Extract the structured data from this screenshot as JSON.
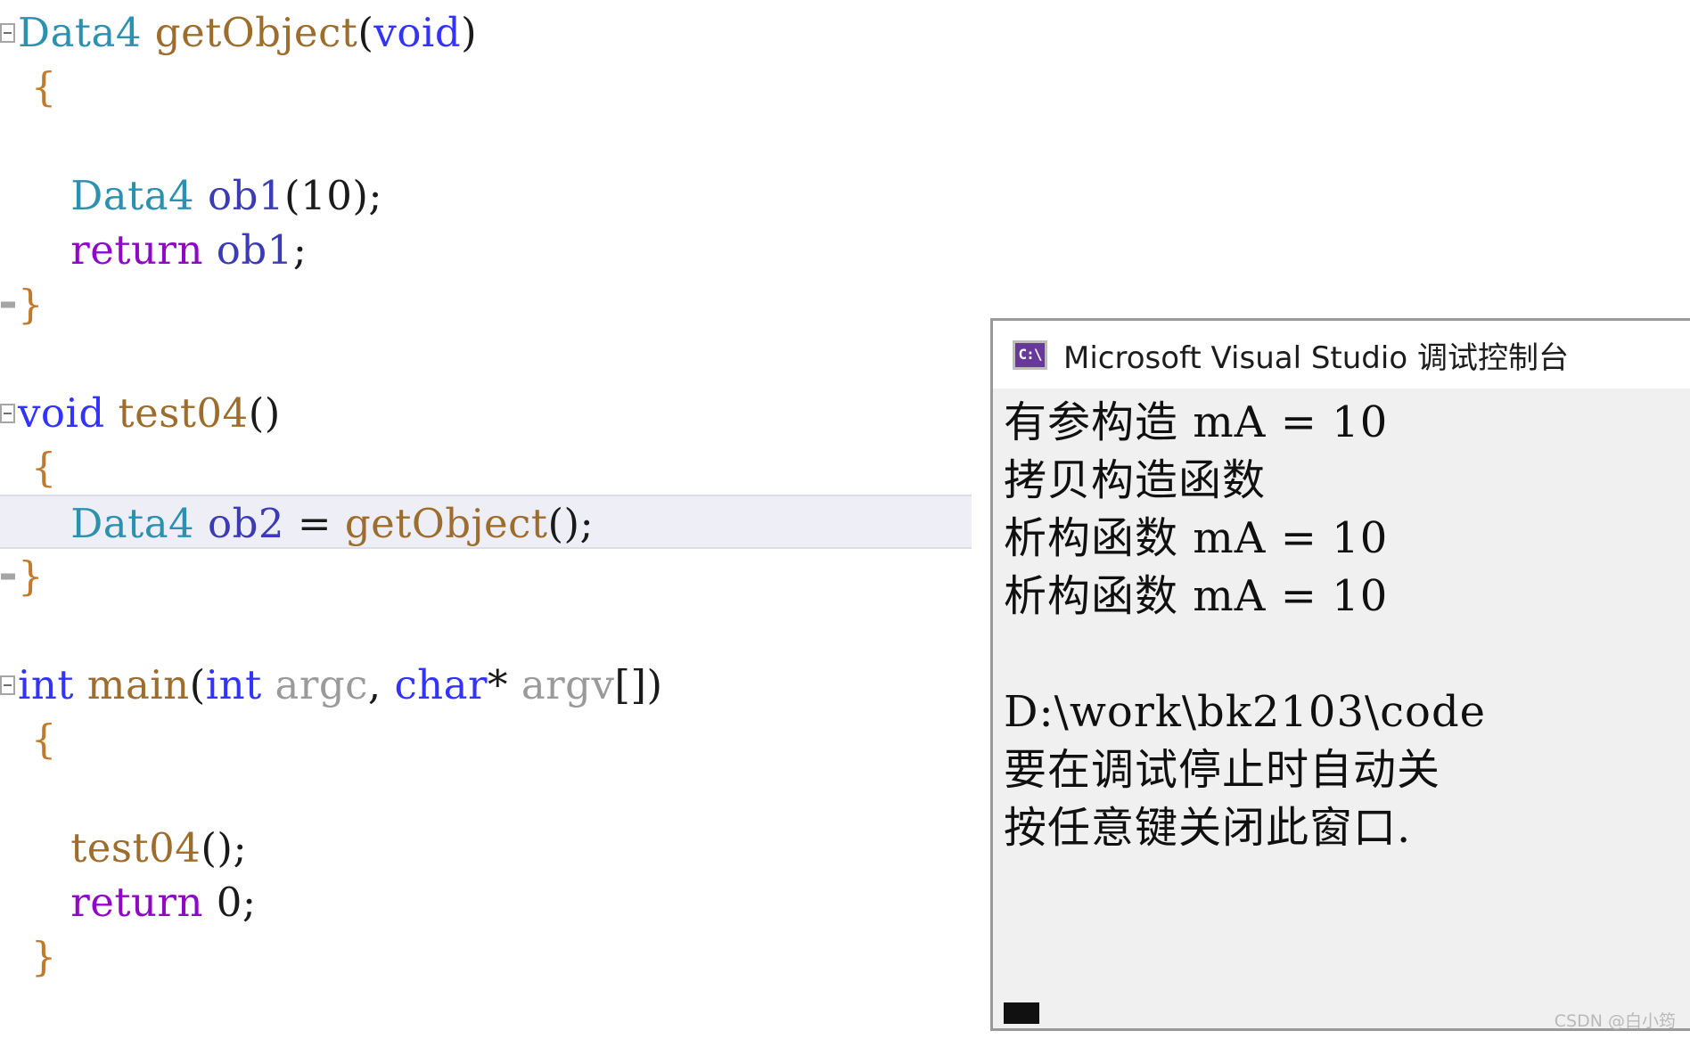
{
  "editor": {
    "name": "visual-studio-code-editor",
    "background": "#ffffff",
    "current_line_highlight": "#eeeef6",
    "colors": {
      "type": "#2b91af",
      "keyword": "#3333ff",
      "keyword_return": "#8f08c4",
      "function": "#9d6d2d",
      "variable": "#3b3bb5",
      "parameter": "#9a9a9a",
      "punctuation": "#1a1a1a",
      "brace": "#c07a2e"
    },
    "lines": [
      {
        "id": 1,
        "outline": "collapse",
        "tokens": [
          {
            "t": "Data4",
            "c": "tk-type"
          },
          {
            "t": " ",
            "c": "tk-punct"
          },
          {
            "t": "getObject",
            "c": "tk-fn"
          },
          {
            "t": "(",
            "c": "tk-punct"
          },
          {
            "t": "void",
            "c": "tk-kw"
          },
          {
            "t": ")",
            "c": "tk-punct"
          }
        ]
      },
      {
        "id": 2,
        "outline": "",
        "tokens": [
          {
            "t": " {",
            "c": "tk-brace"
          }
        ]
      },
      {
        "id": 3,
        "outline": "",
        "tokens": [
          {
            "t": "",
            "c": "tk-punct"
          }
        ]
      },
      {
        "id": 4,
        "outline": "",
        "tokens": [
          {
            "t": "    ",
            "c": "tk-punct"
          },
          {
            "t": "Data4",
            "c": "tk-type"
          },
          {
            "t": " ",
            "c": "tk-punct"
          },
          {
            "t": "ob1",
            "c": "tk-var"
          },
          {
            "t": "(",
            "c": "tk-punct"
          },
          {
            "t": "10",
            "c": "tk-num"
          },
          {
            "t": ");",
            "c": "tk-punct"
          }
        ]
      },
      {
        "id": 5,
        "outline": "",
        "tokens": [
          {
            "t": "    ",
            "c": "tk-punct"
          },
          {
            "t": "return",
            "c": "tk-kw2"
          },
          {
            "t": " ",
            "c": "tk-punct"
          },
          {
            "t": "ob1",
            "c": "tk-var"
          },
          {
            "t": ";",
            "c": "tk-punct"
          }
        ]
      },
      {
        "id": 6,
        "outline": "end",
        "tokens": [
          {
            "t": "}",
            "c": "tk-brace"
          }
        ]
      },
      {
        "id": 7,
        "outline": "",
        "tokens": [
          {
            "t": "",
            "c": "tk-punct"
          }
        ]
      },
      {
        "id": 8,
        "outline": "collapse",
        "tokens": [
          {
            "t": "void",
            "c": "tk-kw"
          },
          {
            "t": " ",
            "c": "tk-punct"
          },
          {
            "t": "test04",
            "c": "tk-fn"
          },
          {
            "t": "()",
            "c": "tk-punct"
          }
        ]
      },
      {
        "id": 9,
        "outline": "",
        "tokens": [
          {
            "t": " {",
            "c": "tk-brace"
          }
        ]
      },
      {
        "id": 10,
        "outline": "",
        "current": true,
        "tokens": [
          {
            "t": "    ",
            "c": "tk-punct"
          },
          {
            "t": "Data4",
            "c": "tk-type"
          },
          {
            "t": " ",
            "c": "tk-punct"
          },
          {
            "t": "ob2",
            "c": "tk-var"
          },
          {
            "t": " = ",
            "c": "tk-punct"
          },
          {
            "t": "getObject",
            "c": "tk-fn"
          },
          {
            "t": "();",
            "c": "tk-punct"
          }
        ]
      },
      {
        "id": 11,
        "outline": "end",
        "tokens": [
          {
            "t": "}",
            "c": "tk-brace"
          }
        ]
      },
      {
        "id": 12,
        "outline": "",
        "tokens": [
          {
            "t": "",
            "c": "tk-punct"
          }
        ]
      },
      {
        "id": 13,
        "outline": "collapse",
        "tokens": [
          {
            "t": "int",
            "c": "tk-kw"
          },
          {
            "t": " ",
            "c": "tk-punct"
          },
          {
            "t": "main",
            "c": "tk-fn"
          },
          {
            "t": "(",
            "c": "tk-punct"
          },
          {
            "t": "int",
            "c": "tk-kw"
          },
          {
            "t": " ",
            "c": "tk-punct"
          },
          {
            "t": "argc",
            "c": "tk-param"
          },
          {
            "t": ", ",
            "c": "tk-punct"
          },
          {
            "t": "char",
            "c": "tk-kw"
          },
          {
            "t": "* ",
            "c": "tk-punct"
          },
          {
            "t": "argv",
            "c": "tk-param"
          },
          {
            "t": "[])",
            "c": "tk-punct"
          }
        ]
      },
      {
        "id": 14,
        "outline": "",
        "tokens": [
          {
            "t": " {",
            "c": "tk-brace"
          }
        ]
      },
      {
        "id": 15,
        "outline": "",
        "tokens": [
          {
            "t": "",
            "c": "tk-punct"
          }
        ]
      },
      {
        "id": 16,
        "outline": "",
        "tokens": [
          {
            "t": "    ",
            "c": "tk-punct"
          },
          {
            "t": "test04",
            "c": "tk-fn"
          },
          {
            "t": "();",
            "c": "tk-punct"
          }
        ]
      },
      {
        "id": 17,
        "outline": "",
        "tokens": [
          {
            "t": "    ",
            "c": "tk-punct"
          },
          {
            "t": "return",
            "c": "tk-kw2"
          },
          {
            "t": " ",
            "c": "tk-punct"
          },
          {
            "t": "0",
            "c": "tk-num"
          },
          {
            "t": ";",
            "c": "tk-punct"
          }
        ]
      },
      {
        "id": 18,
        "outline": "",
        "tokens": [
          {
            "t": " }",
            "c": "tk-brace"
          }
        ]
      }
    ]
  },
  "console": {
    "title": "Microsoft Visual Studio 调试控制台",
    "icon_glyph": "C:\\",
    "icon_color": "#68389b",
    "background": "#f0f0f0",
    "titlebar_background": "#ffffff",
    "border_color": "#9a9a9a",
    "output": [
      "有参构造 mA = 10",
      "拷贝构造函数",
      "析构函数 mA = 10",
      "析构函数 mA = 10",
      "",
      "D:\\work\\bk2103\\code",
      "要在调试停止时自动关",
      "按任意键关闭此窗口."
    ]
  },
  "watermark": {
    "text": "CSDN @白小筠"
  }
}
